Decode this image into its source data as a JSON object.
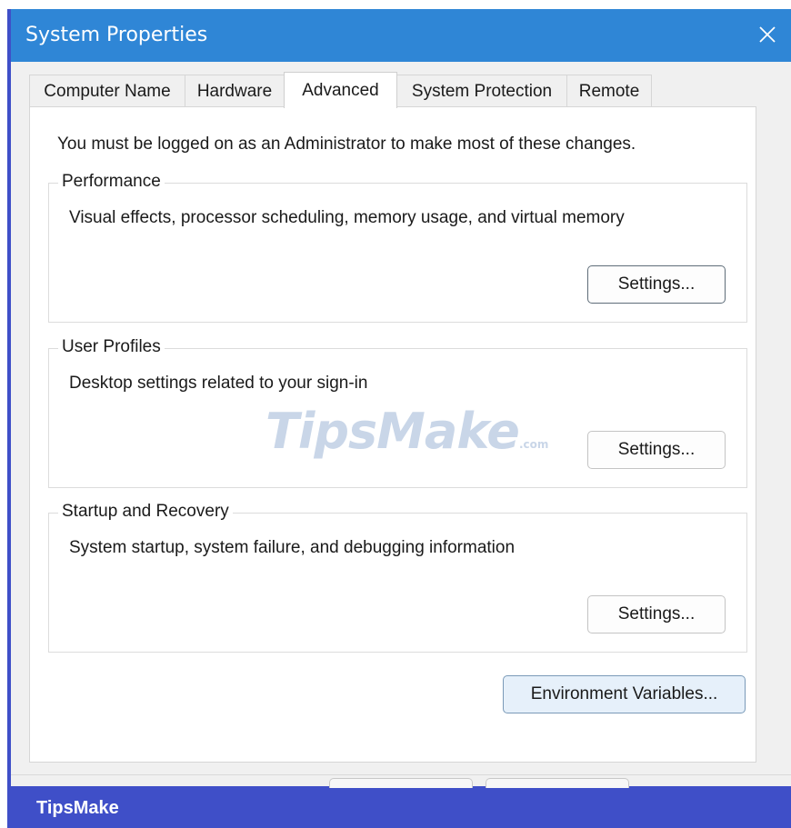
{
  "window": {
    "title": "System Properties",
    "close_icon": "close-icon"
  },
  "tabs": [
    {
      "label": "Computer Name",
      "active": false
    },
    {
      "label": "Hardware",
      "active": false
    },
    {
      "label": "Advanced",
      "active": true
    },
    {
      "label": "System Protection",
      "active": false
    },
    {
      "label": "Remote",
      "active": false
    }
  ],
  "advanced": {
    "notice": "You must be logged on as an Administrator to make most of these changes.",
    "performance": {
      "title": "Performance",
      "description": "Visual effects, processor scheduling, memory usage, and virtual memory",
      "button": "Settings..."
    },
    "user_profiles": {
      "title": "User Profiles",
      "description": "Desktop settings related to your sign-in",
      "button": "Settings..."
    },
    "startup_recovery": {
      "title": "Startup and Recovery",
      "description": "System startup, system failure, and debugging information",
      "button": "Settings..."
    },
    "environment_variables_button": "Environment Variables..."
  },
  "watermark": {
    "text": "TipsMake",
    "suffix": ".com"
  },
  "footer": {
    "brand": "TipsMake"
  },
  "colors": {
    "frame": "#3f4fc8",
    "titlebar": "#2f86d6",
    "panel": "#ffffff",
    "dialog_bg": "#f0f0f0"
  }
}
